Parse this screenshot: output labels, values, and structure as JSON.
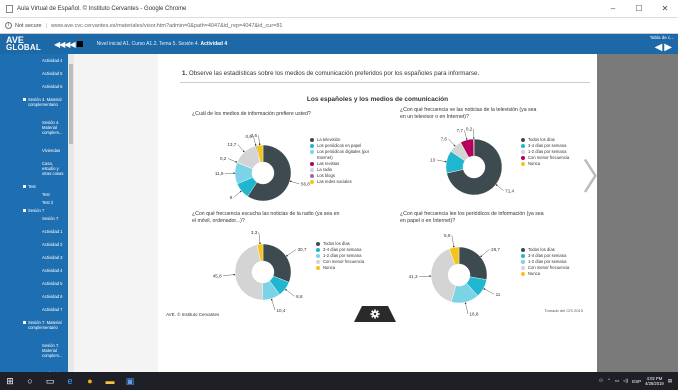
{
  "browser": {
    "window_title": "Aula Virtual de Español. © Instituto Cervantes - Google Chrome",
    "security_label": "Not secure",
    "url": "www.ave.cvc.cervantes.es/materiales/visor.htm?admin=0&path=4047&id_rep=4047&id_cur=81"
  },
  "ave_header": {
    "logo_line1": "AVE",
    "logo_line2": "GLOBAL",
    "arrows": "◀◀◀◀",
    "breadcrumb": "Nivel inicial A1. Curso A1.2. Tema 5. Sesión 4. ",
    "breadcrumb_bold": "Actividad 4",
    "tabla_label": "Tabla de c..."
  },
  "sidebar": {
    "items": [
      {
        "label": "Actividad 4",
        "level": 2
      },
      {
        "label": "Actividad 5",
        "level": 2
      },
      {
        "label": "Actividad 6",
        "level": 2
      },
      {
        "label": "Sesión 4. Material complementario",
        "level": 1
      },
      {
        "label": "Sesión 4. Material complem...",
        "level": 2
      },
      {
        "label": "Viviendas",
        "level": 2
      },
      {
        "label": "Casa, estudio y otras cosas",
        "level": 2
      },
      {
        "label": "Test",
        "level": 1
      },
      {
        "label": "Test",
        "level": 2
      },
      {
        "label": "Test 2",
        "level": 2
      },
      {
        "label": "Sesión 7",
        "level": 1
      },
      {
        "label": "Sesión 7",
        "level": 2
      },
      {
        "label": "Actividad 1",
        "level": 2
      },
      {
        "label": "Actividad 2",
        "level": 2
      },
      {
        "label": "Actividad 3",
        "level": 2
      },
      {
        "label": "Actividad 4",
        "level": 2
      },
      {
        "label": "Actividad 5",
        "level": 2
      },
      {
        "label": "Actividad 6",
        "level": 2
      },
      {
        "label": "Actividad 7",
        "level": 2
      },
      {
        "label": "Sesión 7. Material complementario",
        "level": 1
      },
      {
        "label": "Sesión 7. Material complem...",
        "level": 2
      },
      {
        "label": "Radio y las informaciones sobre el transporte en España",
        "level": 2
      }
    ]
  },
  "content": {
    "instruction_number": "1.",
    "instruction": "Observe las estadísticas sobre los medios de comunicación preferidos por los españoles para informarse.",
    "main_title": "Los españoles y los medios de comunicación",
    "footer_left": "AVE. © Instituto Cervantes",
    "footer_right": "Tomado del CIS 2013"
  },
  "colors": {
    "dark": "#3d4a4f",
    "cyan": "#1fb6cf",
    "light_gray": "#d4d4d4",
    "magenta": "#b3005e",
    "yellow": "#f4c519",
    "light_blue": "#7dd3e6",
    "sidebar_blue": "#1e6fb1",
    "header_blue": "#1d69a8"
  },
  "chart_data": [
    {
      "type": "pie",
      "title": "¿Cuál de los medios de información prefiere usted?",
      "series": [
        {
          "name": "La televisión",
          "value": 56.8,
          "color": "#3d4a4f"
        },
        {
          "name": "Los periódicos en papel",
          "value": 9.0,
          "color": "#1fb6cf"
        },
        {
          "name": "Los periódicos digitales (por Internet)",
          "value": 11.9,
          "color": "#7dd3e6"
        },
        {
          "name": "Las revistas",
          "value": 0.2,
          "color": "#b3005e"
        },
        {
          "name": "La radio",
          "value": 13.7,
          "color": "#d4d4d4"
        },
        {
          "name": "Los blogs",
          "value": 0.6,
          "color": "#9a6a9a"
        },
        {
          "name": "Las redes sociales",
          "value": 3.6,
          "color": "#f4c519"
        }
      ]
    },
    {
      "type": "pie",
      "title": "¿Con qué frecuencia ve las noticias de la televisión (ya sea en un televisor o en Internet)?",
      "series": [
        {
          "name": "Todos los días",
          "value": 71.4,
          "color": "#3d4a4f"
        },
        {
          "name": "3-4 días por semana",
          "value": 13.0,
          "color": "#1fb6cf"
        },
        {
          "name": "1-2 días por semana",
          "value": 7.6,
          "color": "#d4d4d4"
        },
        {
          "name": "Con menor frecuencia",
          "value": 7.7,
          "color": "#b3005e"
        },
        {
          "name": "Nunca",
          "value": 0.2,
          "color": "#f4c519"
        }
      ]
    },
    {
      "type": "pie",
      "title": "¿Con qué frecuencia escucha las noticias de la radio (ya sea en el móvil, ordenador...)?",
      "series": [
        {
          "name": "Todos los días",
          "value": 30.7,
          "color": "#3d4a4f"
        },
        {
          "name": "3-4 días por semana",
          "value": 8.8,
          "color": "#1fb6cf"
        },
        {
          "name": "1-2 días por semana",
          "value": 10.4,
          "color": "#7dd3e6"
        },
        {
          "name": "Con menor frecuencia",
          "value": 45.8,
          "color": "#d4d4d4"
        },
        {
          "name": "Nunca",
          "value": 3.3,
          "color": "#f4c519"
        }
      ]
    },
    {
      "type": "pie",
      "title": "¿Con qué frecuencia lee los periódicos de información (ya sea en papel o en Internet)?",
      "series": [
        {
          "name": "Todos los días",
          "value": 28.7,
          "color": "#3d4a4f"
        },
        {
          "name": "3-4 días por semana",
          "value": 11.0,
          "color": "#1fb6cf"
        },
        {
          "name": "1-2 días por semana",
          "value": 16.8,
          "color": "#7dd3e6"
        },
        {
          "name": "Con menor frecuencia",
          "value": 41.3,
          "color": "#d4d4d4"
        },
        {
          "name": "Nunca",
          "value": 5.9,
          "color": "#f4c519"
        }
      ]
    }
  ],
  "taskbar": {
    "lang": "ESP",
    "time": "4:02 PM",
    "date": "4/26/2019"
  }
}
